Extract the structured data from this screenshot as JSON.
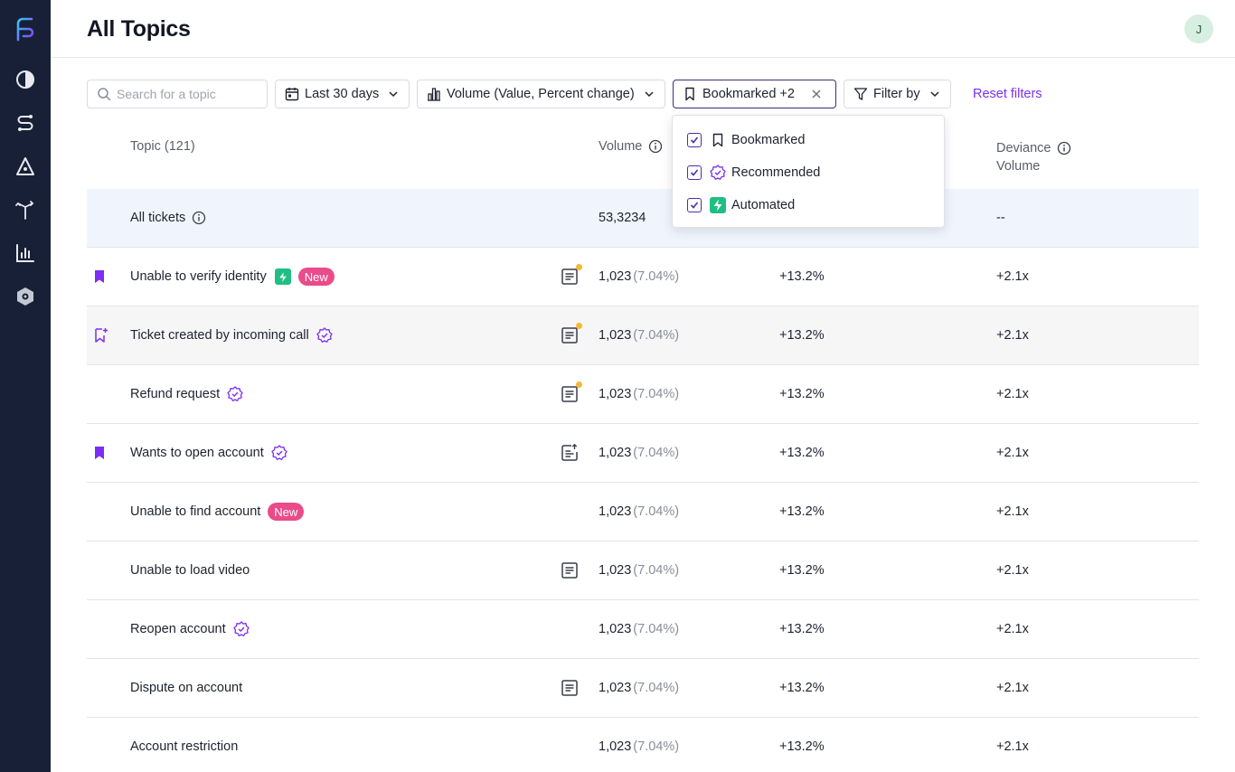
{
  "app": {
    "title": "All Topics",
    "avatar_initial": "J"
  },
  "sidebar": {
    "items": [
      {
        "icon": "half-circle-icon"
      },
      {
        "icon": "flow-icon"
      },
      {
        "icon": "triangle-icon"
      },
      {
        "icon": "split-arrows-icon"
      },
      {
        "icon": "bar-chart-icon"
      },
      {
        "icon": "hexagon-settings-icon"
      }
    ]
  },
  "toolbar": {
    "search_placeholder": "Search for a topic",
    "date_label": "Last 30 days",
    "metric_label": "Volume (Value, Percent change)",
    "bookmark_filter_label": "Bookmarked +2",
    "filter_by_label": "Filter by",
    "reset_label": "Reset filters"
  },
  "dropdown": {
    "options": [
      {
        "label": "Bookmarked",
        "checked": true,
        "icon": "bookmark-icon"
      },
      {
        "label": "Recommended",
        "checked": true,
        "icon": "recommended-badge-icon"
      },
      {
        "label": "Automated",
        "checked": true,
        "icon": "lightning-icon"
      }
    ]
  },
  "table": {
    "headers": {
      "topic": "Topic (121)",
      "volume": "Volume",
      "deviance_line1": "Deviance",
      "deviance_line2": "Volume"
    },
    "all_tickets": {
      "label": "All tickets",
      "volume": "53,3234",
      "deviance": "--"
    },
    "rows": [
      {
        "topic": "Unable to verify identity",
        "bookmark": "filled",
        "automated": true,
        "new": "New",
        "doc": "dot",
        "volume": "1,023",
        "pct": "(7.04%)",
        "change": "+13.2%",
        "deviance": "+2.1x"
      },
      {
        "topic": "Ticket created by incoming call",
        "bookmark": "add",
        "recommended": true,
        "doc": "dot",
        "volume": "1,023",
        "pct": "(7.04%)",
        "change": "+13.2%",
        "deviance": "+2.1x"
      },
      {
        "topic": "Refund request",
        "recommended": true,
        "doc": "dot",
        "volume": "1,023",
        "pct": "(7.04%)",
        "change": "+13.2%",
        "deviance": "+2.1x"
      },
      {
        "topic": "Wants to open account",
        "bookmark": "filled",
        "recommended": true,
        "doc": "export",
        "volume": "1,023",
        "pct": "(7.04%)",
        "change": "+13.2%",
        "deviance": "+2.1x"
      },
      {
        "topic": "Unable to find account",
        "new": "New",
        "volume": "1,023",
        "pct": "(7.04%)",
        "change": "+13.2%",
        "deviance": "+2.1x"
      },
      {
        "topic": "Unable to load video",
        "doc": "plain",
        "volume": "1,023",
        "pct": "(7.04%)",
        "change": "+13.2%",
        "deviance": "+2.1x"
      },
      {
        "topic": "Reopen account",
        "recommended": true,
        "volume": "1,023",
        "pct": "(7.04%)",
        "change": "+13.2%",
        "deviance": "+2.1x"
      },
      {
        "topic": "Dispute on account",
        "doc": "plain",
        "volume": "1,023",
        "pct": "(7.04%)",
        "change": "+13.2%",
        "deviance": "+2.1x"
      },
      {
        "topic": "Account restriction",
        "volume": "1,023",
        "pct": "(7.04%)",
        "change": "+13.2%",
        "deviance": "+2.1x"
      }
    ]
  },
  "colors": {
    "sidebar_bg": "#172036",
    "accent_purple": "#7b2ff2",
    "badge_pink": "#ea4b8a",
    "automated_green": "#1fbf83",
    "notice_dot": "#f5b836"
  }
}
